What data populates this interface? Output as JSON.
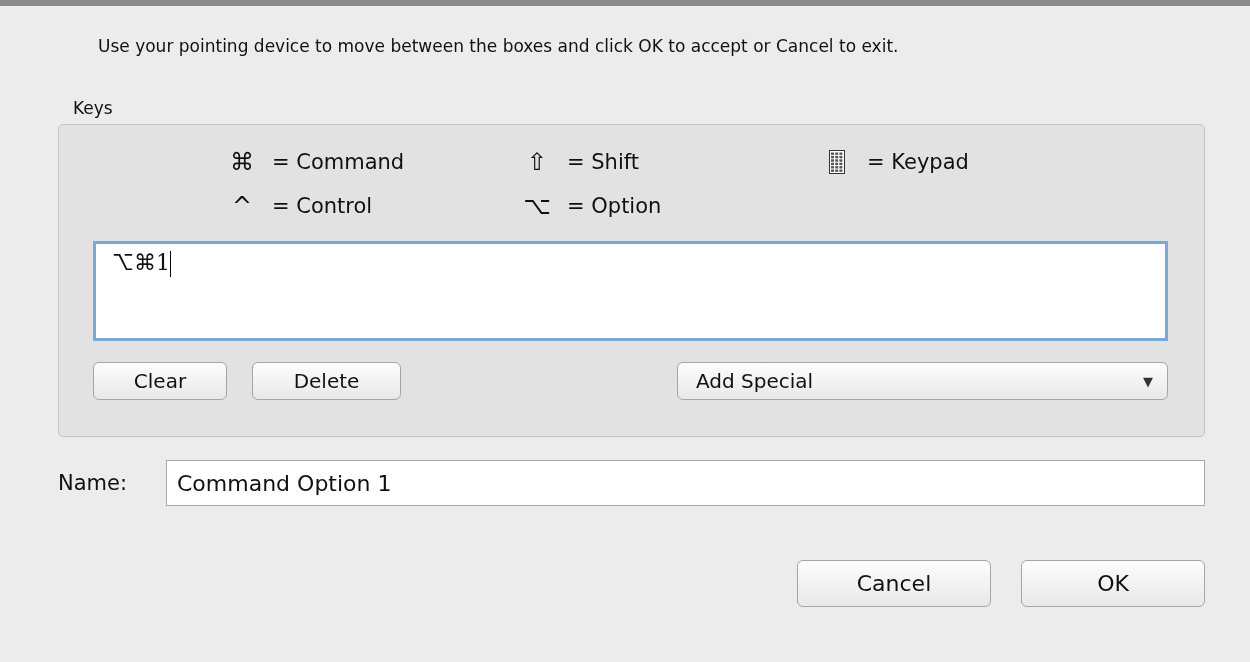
{
  "instructions": "Use your pointing device to move between the boxes and click OK to accept or Cancel to exit.",
  "keys_group": {
    "label": "Keys",
    "legend": [
      {
        "kind": "glyph",
        "symbol": "⌘",
        "meaning": "= Command"
      },
      {
        "kind": "glyph",
        "symbol": "⇧",
        "meaning": "= Shift"
      },
      {
        "kind": "icon",
        "meaning": "= Keypad"
      },
      {
        "kind": "glyph",
        "symbol": "^",
        "meaning": "= Control"
      },
      {
        "kind": "glyph",
        "symbol": "⌥",
        "meaning": "= Option"
      }
    ],
    "shortcut_field": {
      "value": "⌥⌘1",
      "focused": true
    },
    "buttons": [
      "Clear",
      "Delete"
    ],
    "add_special": {
      "label": "Add Special",
      "arrow": "▼"
    }
  },
  "name": {
    "label": "Name:",
    "value": "Command Option 1"
  },
  "buttons": [
    "Cancel",
    "OK"
  ]
}
